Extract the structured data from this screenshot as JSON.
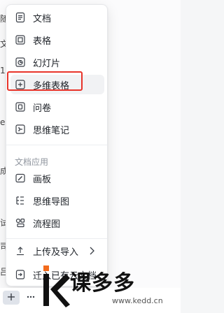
{
  "background": {
    "edge_chars": [
      "随",
      "文",
      "1",
      "e",
      "成",
      "试",
      "司",
      "吕"
    ]
  },
  "menu": {
    "items": [
      {
        "label": "文档",
        "icon": "doc-icon"
      },
      {
        "label": "表格",
        "icon": "sheet-icon"
      },
      {
        "label": "幻灯片",
        "icon": "slides-icon"
      },
      {
        "label": "多维表格",
        "icon": "bitable-icon"
      },
      {
        "label": "问卷",
        "icon": "survey-icon"
      },
      {
        "label": "思维笔记",
        "icon": "mindnote-icon"
      }
    ],
    "section_label": "文档应用",
    "app_items": [
      {
        "label": "画板",
        "icon": "whiteboard-icon"
      },
      {
        "label": "思维导图",
        "icon": "mindmap-icon"
      },
      {
        "label": "流程图",
        "icon": "flowchart-icon"
      }
    ],
    "actions": [
      {
        "label": "上传及导入",
        "icon": "upload-icon"
      },
      {
        "label": "迁入已有云文档",
        "icon": "move-in-icon"
      }
    ]
  },
  "toolbar": {
    "plus_icon": "plus-icon",
    "more_icon": "more-icon"
  },
  "watermark": {
    "brand": "课多多",
    "url": "www.kedd.cn"
  },
  "colors": {
    "highlight": "#e8342a",
    "plus_bg": "#dfe3ea",
    "brand_orange": "#f36b1c"
  }
}
